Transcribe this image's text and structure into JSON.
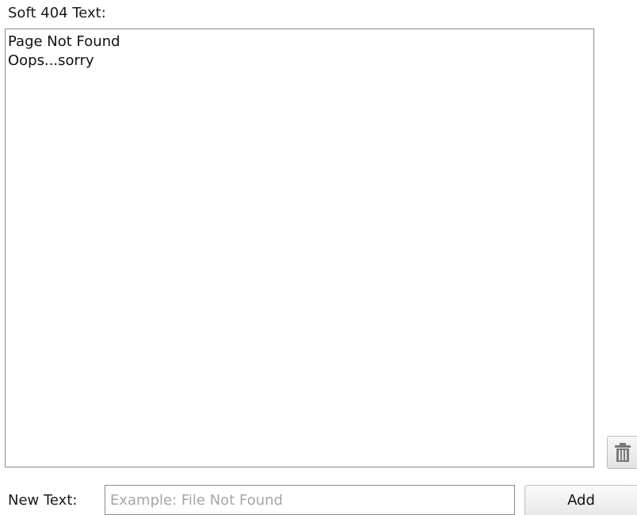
{
  "soft404": {
    "label": "Soft 404 Text:",
    "items": [
      "Page Not Found",
      "Oops...sorry"
    ]
  },
  "toolbar": {
    "delete_icon": "trash-icon"
  },
  "new_text": {
    "label": "New Text:",
    "value": "",
    "placeholder": "Example: File Not Found",
    "add_label": "Add"
  }
}
